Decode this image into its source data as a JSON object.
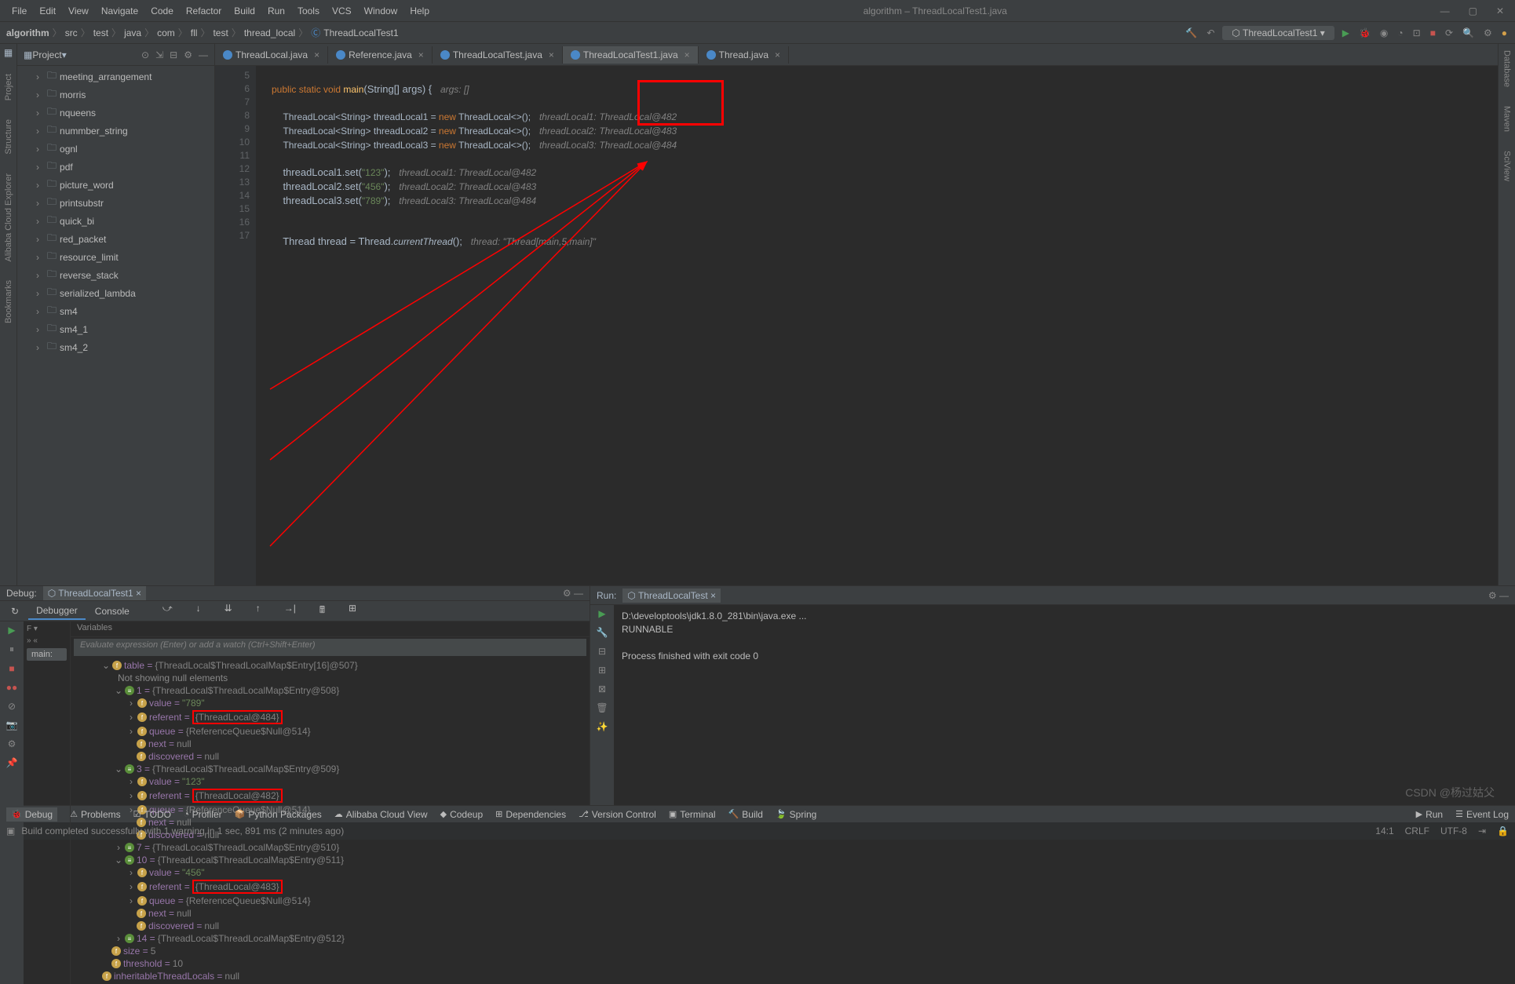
{
  "window": {
    "title": "algorithm – ThreadLocalTest1.java"
  },
  "menu": [
    "File",
    "Edit",
    "View",
    "Navigate",
    "Code",
    "Refactor",
    "Build",
    "Run",
    "Tools",
    "VCS",
    "Window",
    "Help"
  ],
  "breadcrumb": [
    "algorithm",
    "src",
    "test",
    "java",
    "com",
    "fll",
    "test",
    "thread_local",
    "ThreadLocalTest1"
  ],
  "run_config": "ThreadLocalTest1",
  "project_panel": {
    "title": "Project"
  },
  "project_tree": [
    "meeting_arrangement",
    "morris",
    "nqueens",
    "nummber_string",
    "ognl",
    "pdf",
    "picture_word",
    "printsubstr",
    "quick_bi",
    "red_packet",
    "resource_limit",
    "reverse_stack",
    "serialized_lambda",
    "sm4",
    "sm4_1",
    "sm4_2"
  ],
  "editor_tabs": [
    {
      "name": "ThreadLocal.java"
    },
    {
      "name": "Reference.java"
    },
    {
      "name": "ThreadLocalTest.java"
    },
    {
      "name": "ThreadLocalTest1.java",
      "active": true
    },
    {
      "name": "Thread.java"
    }
  ],
  "code": {
    "line5": {
      "sig": "public static void main(String[] args) {",
      "hint": "args: []"
    },
    "line7": {
      "decl": "ThreadLocal<String> threadLocal1 = ",
      "new": "new",
      "ctor": " ThreadLocal<>();",
      "h1": "threadLocal1:",
      "h2": "ThreadLocal@482"
    },
    "line8": {
      "decl": "ThreadLocal<String> threadLocal2 = ",
      "new": "new",
      "ctor": " ThreadLocal<>();",
      "h1": "threadLocal2:",
      "h2": "ThreadLocal@483"
    },
    "line9": {
      "decl": "ThreadLocal<String> threadLocal3 = ",
      "new": "new",
      "ctor": " ThreadLocal<>();",
      "h1": "threadLocal3:",
      "h2": "ThreadLocal@484"
    },
    "line11": {
      "code": "threadLocal1.set(\"123\");",
      "hint": "threadLocal1: ThreadLocal@482"
    },
    "line12": {
      "code": "threadLocal2.set(\"456\");",
      "hint": "threadLocal2: ThreadLocal@483"
    },
    "line13": {
      "code": "threadLocal3.set(\"789\");",
      "hint": "threadLocal3: ThreadLocal@484"
    },
    "line16": {
      "code": "Thread thread = Thread.currentThread();",
      "hint": "thread: \"Thread[main,5,main]\""
    }
  },
  "gutter_lines": [
    "5",
    "6",
    "7",
    "8",
    "9",
    "10",
    "11",
    "12",
    "13",
    "14",
    "15",
    "16",
    "17"
  ],
  "debug": {
    "title": "Debug:",
    "tab": "ThreadLocalTest1",
    "tabs": [
      "Debugger",
      "Console"
    ],
    "frame": "main:",
    "vars_label": "Variables",
    "eval_placeholder": "Evaluate expression (Enter) or add a watch (Ctrl+Shift+Enter)",
    "vars": {
      "table": {
        "label": "table = ",
        "val": "{ThreadLocal$ThreadLocalMap$Entry[16]@507}"
      },
      "not_showing": "Not showing null elements",
      "e1": {
        "label": "1 = ",
        "val": "{ThreadLocal$ThreadLocalMap$Entry@508}"
      },
      "e1_value": {
        "label": "value = ",
        "val": "\"789\""
      },
      "e1_ref": {
        "label": "referent = ",
        "val": "{ThreadLocal@484}"
      },
      "e1_queue": {
        "label": "queue = ",
        "val": "{ReferenceQueue$Null@514}"
      },
      "e1_next": {
        "label": "next = ",
        "val": "null"
      },
      "e1_disc": {
        "label": "discovered = ",
        "val": "null"
      },
      "e3": {
        "label": "3 = ",
        "val": "{ThreadLocal$ThreadLocalMap$Entry@509}"
      },
      "e3_value": {
        "label": "value = ",
        "val": "\"123\""
      },
      "e3_ref": {
        "label": "referent = ",
        "val": "{ThreadLocal@482}"
      },
      "e3_queue": {
        "label": "queue = ",
        "val": "{ReferenceQueue$Null@514}"
      },
      "e3_next": {
        "label": "next = ",
        "val": "null"
      },
      "e3_disc": {
        "label": "discovered = ",
        "val": "null"
      },
      "e7": {
        "label": "7 = ",
        "val": "{ThreadLocal$ThreadLocalMap$Entry@510}"
      },
      "e10": {
        "label": "10 = ",
        "val": "{ThreadLocal$ThreadLocalMap$Entry@511}"
      },
      "e10_value": {
        "label": "value = ",
        "val": "\"456\""
      },
      "e10_ref": {
        "label": "referent = ",
        "val": "{ThreadLocal@483}"
      },
      "e10_queue": {
        "label": "queue = ",
        "val": "{ReferenceQueue$Null@514}"
      },
      "e10_next": {
        "label": "next = ",
        "val": "null"
      },
      "e10_disc": {
        "label": "discovered = ",
        "val": "null"
      },
      "e14": {
        "label": "14 = ",
        "val": "{ThreadLocal$ThreadLocalMap$Entry@512}"
      },
      "size": {
        "label": "size = ",
        "val": "5"
      },
      "threshold": {
        "label": "threshold = ",
        "val": "10"
      },
      "inheritable": {
        "label": "inheritableThreadLocals = ",
        "val": "null"
      }
    }
  },
  "run": {
    "title": "Run:",
    "tab": "ThreadLocalTest",
    "out1": "D:\\developtools\\jdk1.8.0_281\\bin\\java.exe ...",
    "out2": "RUNNABLE",
    "out3": "Process finished with exit code 0"
  },
  "bottom_tabs": [
    "Debug",
    "Problems",
    "TODO",
    "Profiler",
    "Python Packages",
    "Alibaba Cloud View",
    "Codeup",
    "Dependencies",
    "Version Control",
    "Terminal",
    "Build",
    "Spring"
  ],
  "bottom_right": [
    "Run",
    "Event Log"
  ],
  "status": {
    "msg": "Build completed successfully with 1 warning in 1 sec, 891 ms (2 minutes ago)",
    "pos": "14:1",
    "crlf": "CRLF",
    "enc": "UTF-8"
  },
  "watermark": "CSDN @杨过姑父"
}
